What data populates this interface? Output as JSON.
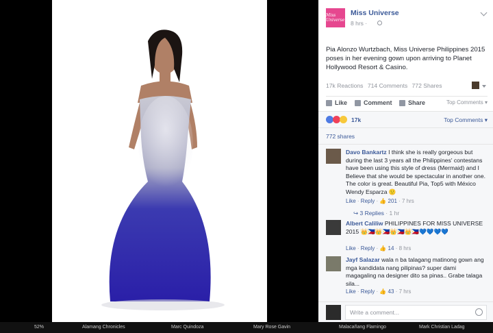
{
  "post": {
    "page_name": "Miss Universe",
    "avatar_text": "Miss Universe",
    "time": "8 hrs ·",
    "caption": "Pia Alonzo Wurtzbach, Miss Universe Philippines 2015 poses in her evening gown upon arriving to Planet Hollywood Resort & Casino.",
    "reactions_stat": "17k Reactions",
    "comments_stat": "714 Comments",
    "shares_stat": "772 Shares",
    "like_label": "Like",
    "comment_label": "Comment",
    "share_label": "Share",
    "sort_label": "Top Comments ▾"
  },
  "reactions_bar": {
    "count": "17k",
    "sort_label": "Top Comments ▾",
    "colors": {
      "like": "#4e7ae3",
      "love": "#f0415a",
      "wow": "#f7c83b"
    }
  },
  "shares_line": "772 shares",
  "comments": [
    {
      "name": "Davo Bankartz",
      "text": "I think she is really gorgeous but during the last 3 years all the Philippines' contestans have been using this style of dress (Mermaid) and I Believe that she would be spectacular in another one. The color is great. Beautiful Pia, Top5 with México Wendy Esparza 🙂",
      "like": "Like",
      "reply": "Reply",
      "reactions": "201",
      "time": "7 hrs",
      "replies": "3 Replies",
      "replies_time": "1 hr"
    },
    {
      "name": "Albert Caliliw",
      "text": "PHILIPPINES FOR MISS UNIVERSE 2015 👑🇵🇭👑🇵🇭👑🇵🇭👑🇵🇭💙💙💙💙",
      "like": "Like",
      "reply": "Reply",
      "reactions": "14",
      "time": "8 hrs"
    },
    {
      "name": "Jayf Salazar",
      "text": "wala n ba talagang matinong gown ang mga kandidata nang pilipinas? super dami magagaling na designer dito sa pinas.. Grabe talaga sila...",
      "like": "Like",
      "reply": "Reply",
      "reactions": "43",
      "time": "7 hrs"
    }
  ],
  "write_placeholder": "Write a comment...",
  "taskbar": {
    "battery": "52%",
    "items": [
      "Alamang Chronicles",
      "Marc Quindoza",
      "Mary Rose Gavin",
      "Malacañang Flamingo",
      "Mark Christian Ladag"
    ]
  }
}
